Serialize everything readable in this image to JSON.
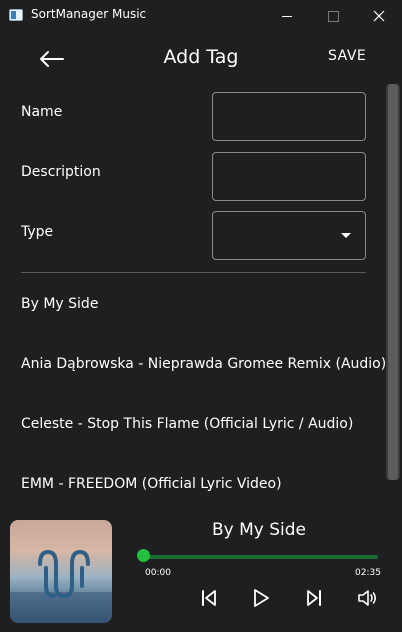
{
  "window": {
    "title": "SortManager Music"
  },
  "header": {
    "title": "Add Tag",
    "save_label": "SAVE"
  },
  "form": {
    "name_label": "Name",
    "name_value": "",
    "description_label": "Description",
    "description_value": "",
    "type_label": "Type",
    "type_value": ""
  },
  "songs": [
    "By My Side",
    "Ania Dąbrowska - Nieprawda Gromee Remix (Audio)",
    "Celeste - Stop This Flame (Official Lyric / Audio)",
    "EMM - FREEDOM (Official Lyric Video)"
  ],
  "player": {
    "title": "By My Side",
    "current_time": "00:00",
    "total_time": "02:35",
    "progress": 0.0
  },
  "colors": {
    "accent": "#22c03b",
    "background": "#1f1f21",
    "field_border": "#8a8a8a"
  },
  "icons": {
    "back": "arrow-left-icon",
    "previous": "skip-previous-icon",
    "play": "play-icon",
    "next": "skip-next-icon",
    "volume": "volume-icon"
  }
}
